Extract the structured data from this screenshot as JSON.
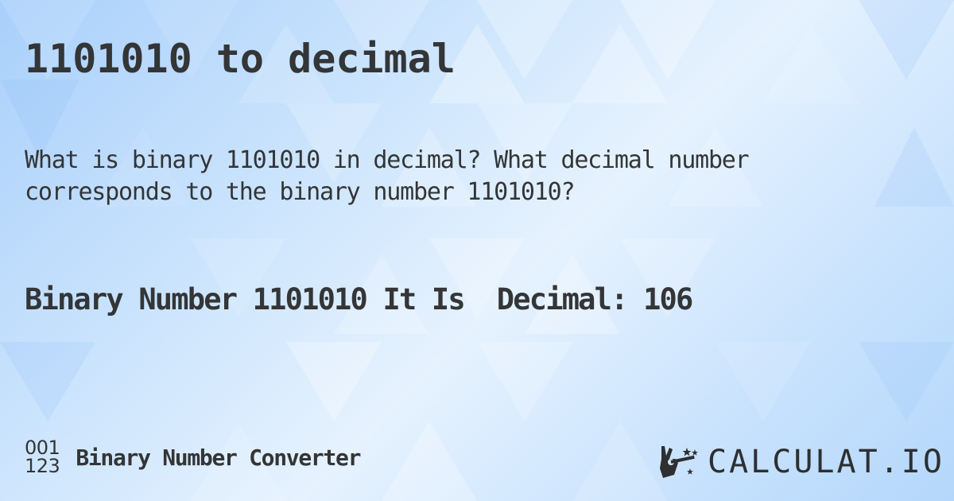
{
  "page": {
    "title": "1101010 to decimal",
    "question": "What is binary 1101010 in decimal? What decimal number corresponds to the binary number 1101010?",
    "answer": "Binary Number 1101010 It Is  Decimal: 106"
  },
  "footer": {
    "icon_top": "001",
    "icon_bottom": "123",
    "converter_label": "Binary Number Converter",
    "brand": "CALCULAT.IO",
    "brand_icon": "magic-wand-hand-icon"
  },
  "colors": {
    "text": "#333537",
    "background_light": "#e6f2fe",
    "background_dark": "#a9d0fb"
  }
}
